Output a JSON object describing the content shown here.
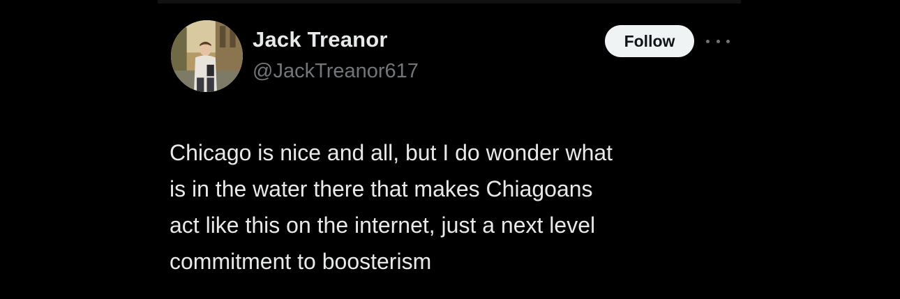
{
  "author": {
    "display_name": "Jack Treanor",
    "handle": "@JackTreanor617",
    "avatar_icon": "profile-photo"
  },
  "actions": {
    "follow_label": "Follow",
    "more_icon": "more-horizontal-icon"
  },
  "tweet": {
    "lines": [
      "Chicago is nice and all, but I do wonder what",
      "is in the water there that makes Chiagoans",
      "act like this on the internet, just a next level",
      "commitment to boosterism"
    ]
  },
  "colors": {
    "background": "#000000",
    "primary_text": "#e7e9ea",
    "secondary_text": "#71767b",
    "follow_bg": "#eff3f4",
    "follow_text": "#0f1419"
  }
}
